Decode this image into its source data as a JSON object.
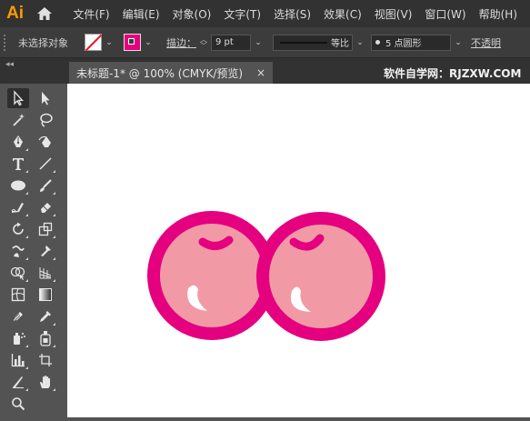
{
  "app": {
    "logo": "Ai"
  },
  "menu": {
    "items": [
      "文件(F)",
      "编辑(E)",
      "对象(O)",
      "文字(T)",
      "选择(S)",
      "效果(C)",
      "视图(V)",
      "窗口(W)",
      "帮助(H)"
    ]
  },
  "control": {
    "selection_label": "未选择对象",
    "stroke_label": "描边：",
    "stroke_weight": "9 pt",
    "profile_label": "等比",
    "brush_label": "5 点圆形",
    "opacity_label": "不透明"
  },
  "document": {
    "tab_title": "未标题-1* @ 100% (CMYK/预览)",
    "close_glyph": "×"
  },
  "watermark": "软件自学网：RJZXW.COM",
  "panel": {
    "collapse_glyph": "◂◂"
  },
  "tools": [
    "selection-tool-icon",
    "direct-selection-tool-icon",
    "magic-wand-tool-icon",
    "lasso-tool-icon",
    "pen-tool-icon",
    "curvature-tool-icon",
    "type-tool-icon",
    "line-segment-tool-icon",
    "ellipse-tool-icon",
    "paintbrush-tool-icon",
    "shaper-tool-icon",
    "eraser-tool-icon",
    "rotate-tool-icon",
    "scale-tool-icon",
    "warp-tool-icon",
    "puppet-warp-tool-icon",
    "shape-builder-tool-icon",
    "perspective-grid-tool-icon",
    "mesh-tool-icon",
    "gradient-tool-icon",
    "eyedropper-tool-icon",
    "eyedropper-alt-tool-icon",
    "symbol-sprayer-tool-icon",
    "live-paint-tool-icon",
    "column-graph-tool-icon",
    "artboard-tool-icon",
    "slice-tool-icon",
    "hand-tool-icon",
    "zoom-tool-icon"
  ],
  "artwork": {
    "fill_color": "#f19aa6",
    "stroke_color": "#e4007f",
    "highlight_color": "#ffffff"
  }
}
